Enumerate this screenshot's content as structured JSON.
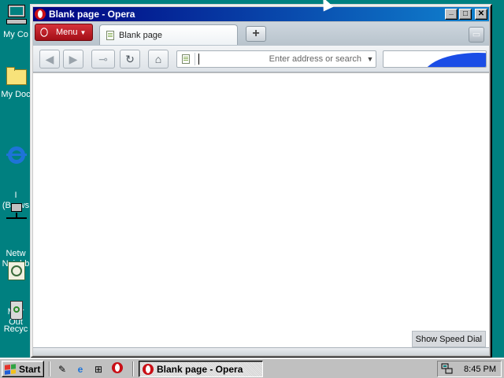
{
  "desktop": {
    "icons": [
      {
        "label": "My Co"
      },
      {
        "label": "My Doc"
      },
      {
        "label": "I\n(Brows"
      },
      {
        "label": "Netw\nNeighb"
      },
      {
        "label": "Micr\nOut"
      },
      {
        "label": "Recyc"
      }
    ]
  },
  "window": {
    "title": "Blank page - Opera",
    "controls": {
      "minimize": "_",
      "maximize": "□",
      "close": "✕"
    }
  },
  "tabstrip": {
    "menu_label": "Menu",
    "tabs": [
      {
        "label": "Blank page"
      }
    ],
    "new_tab_label": "+"
  },
  "toolbar": {
    "address_placeholder": "Enter address or search",
    "address_value": ""
  },
  "content": {
    "speed_dial_label": "Show Speed Dial"
  },
  "taskbar": {
    "start_label": "Start",
    "task_label": "Blank page - Opera",
    "clock": "8:45 PM"
  },
  "colors": {
    "desktop": "#008080",
    "titlebar": "#000080",
    "opera_red": "#cc0f16"
  }
}
